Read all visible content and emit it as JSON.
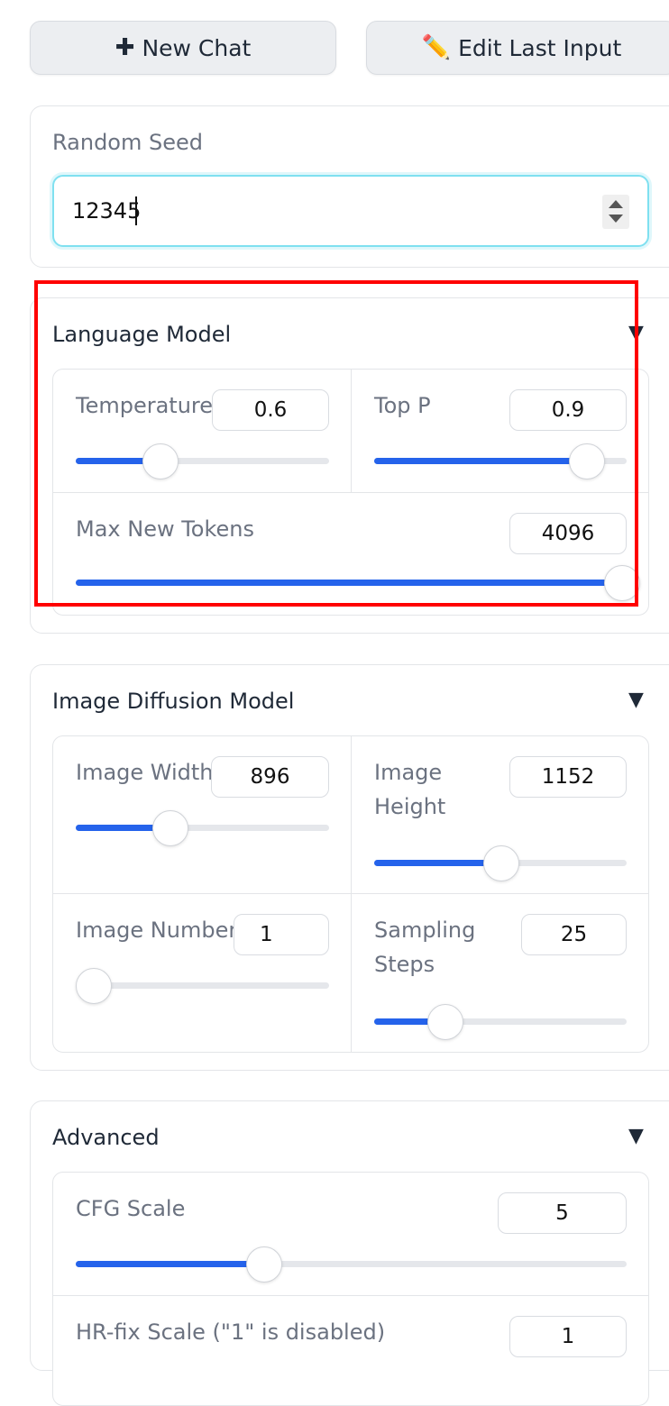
{
  "toolbar": {
    "new_chat": {
      "icon": "plus-icon",
      "icon_glyph": "✚",
      "label": "New Chat"
    },
    "edit_last": {
      "icon": "pencil-icon",
      "icon_glyph": "✏️",
      "label": "Edit Last Input"
    }
  },
  "seed": {
    "label": "Random Seed",
    "value": "12345"
  },
  "language_model": {
    "title": "Language Model",
    "collapse_glyph": "▼",
    "temperature": {
      "label": "Temperature",
      "value": "0.6",
      "level": 0.33
    },
    "top_p": {
      "label": "Top P",
      "value": "0.9",
      "level": 0.84
    },
    "max_new_tokens": {
      "label": "Max New Tokens",
      "value": "4096",
      "level": 0.99
    }
  },
  "image_model": {
    "title": "Image Diffusion Model",
    "collapse_glyph": "▼",
    "width": {
      "label": "Image Width",
      "value": "896",
      "level": 0.37
    },
    "height": {
      "label_line1": "Image",
      "label_line2": "Height",
      "value": "1152",
      "level": 0.5
    },
    "number": {
      "label": "Image Number",
      "value": "1",
      "level": 0.0
    },
    "steps": {
      "label_line1": "Sampling",
      "label_line2": "Steps",
      "value": "25",
      "level": 0.28
    }
  },
  "advanced": {
    "title": "Advanced",
    "collapse_glyph": "▼",
    "cfg": {
      "label": "CFG Scale",
      "value": "5",
      "level": 0.34
    },
    "hr_fix": {
      "label": "HR-fix Scale (\"1\" is disabled)",
      "value": "1"
    }
  },
  "colors": {
    "accent": "#2563eb",
    "highlight": "#ff0000",
    "focus": "#7fe0f0"
  }
}
